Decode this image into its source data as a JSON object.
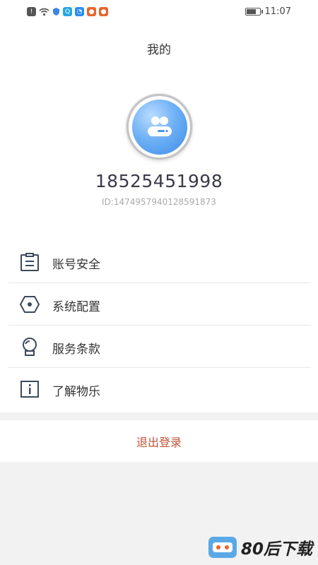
{
  "status_bar": {
    "time": "11:07",
    "icons": [
      "alert-icon",
      "wifi-icon",
      "shield-icon",
      "app-notification-icon",
      "app-notification-icon",
      "app-notification-icon",
      "app-notification-icon"
    ],
    "battery_level": 0.8
  },
  "header": {
    "title": "我的"
  },
  "profile": {
    "username": "18525451998",
    "user_id": "ID:1474957940128591873",
    "avatar_icon": "user-avatar-icon"
  },
  "menu": {
    "items": [
      {
        "label": "账号安全",
        "icon": "document-icon"
      },
      {
        "label": "系统配置",
        "icon": "hexagon-settings-icon"
      },
      {
        "label": "服务条款",
        "icon": "badge-icon"
      },
      {
        "label": "了解物乐",
        "icon": "info-icon"
      }
    ]
  },
  "logout": {
    "label": "退出登录",
    "color": "#c0533a"
  },
  "watermark": {
    "text": "80后下载"
  },
  "colors": {
    "accent": "#3d8be6",
    "icon_stroke": "#3d4a5c",
    "logout": "#c0533a"
  }
}
